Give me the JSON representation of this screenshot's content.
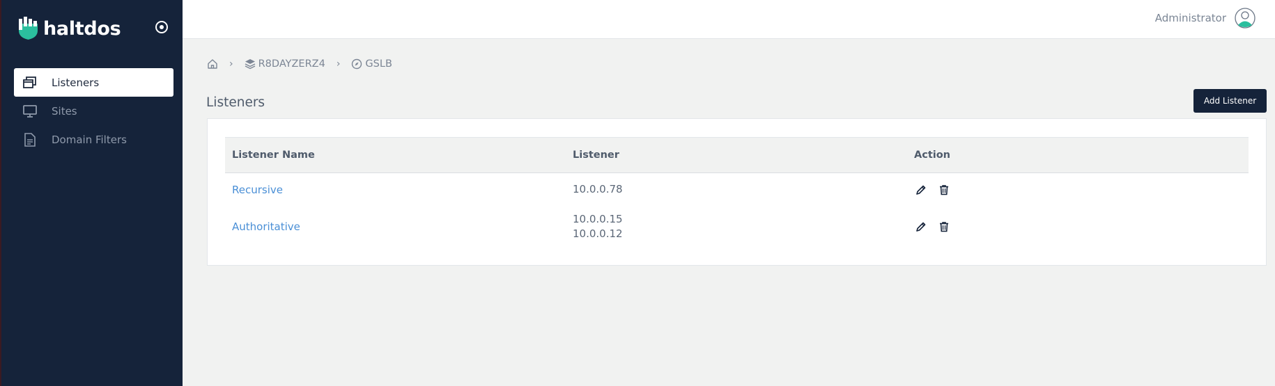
{
  "brand": {
    "name": "haltdos",
    "accent": "#2bbf9e",
    "sidebar_bg": "#15233a"
  },
  "sidebar": {
    "items": [
      {
        "label": "Listeners",
        "icon": "windows-icon",
        "active": true
      },
      {
        "label": "Sites",
        "icon": "monitor-icon",
        "active": false
      },
      {
        "label": "Domain Filters",
        "icon": "document-icon",
        "active": false
      }
    ]
  },
  "header": {
    "user_name": "Administrator"
  },
  "breadcrumb": {
    "items": [
      {
        "label": "",
        "icon": "home-icon"
      },
      {
        "label": "R8DAYZERZ4",
        "icon": "layers-icon"
      },
      {
        "label": "GSLB",
        "icon": "compass-icon"
      }
    ],
    "separator": "›"
  },
  "page": {
    "title": "Listeners",
    "add_button": "Add Listener"
  },
  "table": {
    "columns": [
      "Listener Name",
      "Listener",
      "Action"
    ],
    "rows": [
      {
        "name": "Recursive",
        "listeners": [
          "10.0.0.78"
        ]
      },
      {
        "name": "Authoritative",
        "listeners": [
          "10.0.0.15",
          "10.0.0.12"
        ]
      }
    ]
  }
}
